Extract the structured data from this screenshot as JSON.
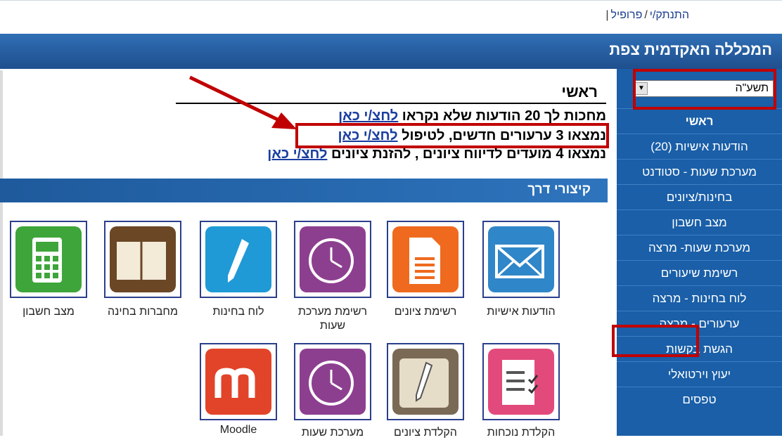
{
  "header": {
    "links": [
      "התנתק/י",
      "פרופיל"
    ],
    "title": "המכללה האקדמית צפת"
  },
  "sidebar": {
    "year_select": "תשע\"ה",
    "items": [
      {
        "label": "ראשי"
      },
      {
        "label": "הודעות אישיות (20)"
      },
      {
        "label": "מערכת שעות - סטודנט"
      },
      {
        "label": "בחינות/ציונים"
      },
      {
        "label": "מצב חשבון"
      },
      {
        "label": "מערכת שעות- מרצה"
      },
      {
        "label": "רשימת שיעורים"
      },
      {
        "label": "לוח בחינות - מרצה"
      },
      {
        "label": "ערעורים - מרצה"
      },
      {
        "label": "הגשת בקשות"
      },
      {
        "label": "יעוץ וירטואלי"
      },
      {
        "label": "טפסים"
      }
    ]
  },
  "main": {
    "title": "ראשי",
    "messages": [
      {
        "text": "מחכות לך 20 הודעות שלא נקראו ",
        "link": "לחצ/י כאן"
      },
      {
        "text": "נמצאו 3 ערעורים חדשים, לטיפול ",
        "link": "לחצ/י כאן"
      },
      {
        "text": "נמצאו 4 מועדים לדיווח ציונים , להזנת ציונים ",
        "link": "לחצ/י כאן"
      }
    ],
    "shortcuts_title": "קיצורי דרך",
    "shortcuts": [
      {
        "label": "הודעות אישיות",
        "icon": "envelope-icon",
        "color": "#2f86c8"
      },
      {
        "label": "רשימת ציונים",
        "icon": "document-icon",
        "color": "#ef6a1f"
      },
      {
        "label": "רשימת מערכת שעות",
        "icon": "clock-icon",
        "color": "#8d3f8f"
      },
      {
        "label": "לוח בחינות",
        "icon": "pen-icon",
        "color": "#1f9ad6"
      },
      {
        "label": "מחברות בחינה",
        "icon": "notebook-icon",
        "color": "#6b4726"
      },
      {
        "label": "מצב חשבון",
        "icon": "calculator-icon",
        "color": "#3ea53a"
      },
      {
        "label": "הקלדת נוכחות",
        "icon": "checklist-icon",
        "color": "#e24a7b"
      },
      {
        "label": "הקלדת ציונים",
        "icon": "grade-pen-icon",
        "color": "#7a6a55"
      },
      {
        "label": "מערכת שעות",
        "icon": "clock-icon",
        "color": "#8d3f8f"
      },
      {
        "label": "Moodle",
        "icon": "moodle-icon",
        "color": "#e2442a"
      }
    ]
  }
}
